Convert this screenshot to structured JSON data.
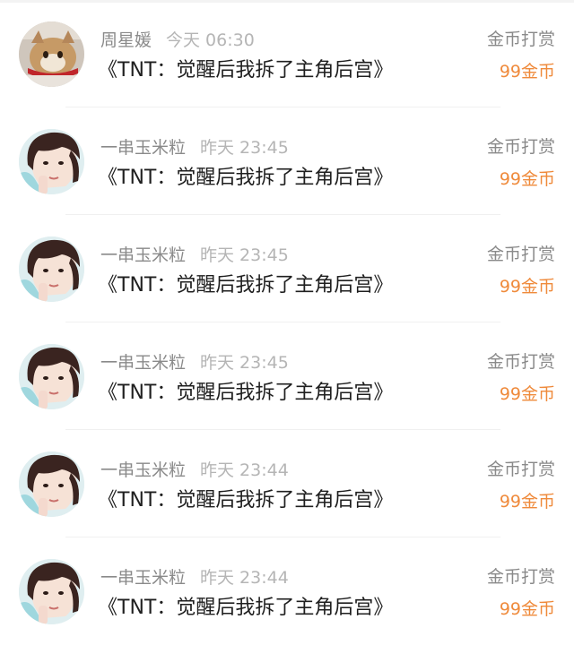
{
  "comments": [
    {
      "avatar": "cat-photo",
      "username": "周星媛",
      "time": "今天 06:30",
      "title": "《TNT：觉醒后我拆了主角后宫》",
      "reward_type": "金币打赏",
      "reward_amount": "99金币"
    },
    {
      "avatar": "boy-photo",
      "username": "一串玉米粒",
      "time": "昨天 23:45",
      "title": "《TNT：觉醒后我拆了主角后宫》",
      "reward_type": "金币打赏",
      "reward_amount": "99金币"
    },
    {
      "avatar": "boy-photo",
      "username": "一串玉米粒",
      "time": "昨天 23:45",
      "title": "《TNT：觉醒后我拆了主角后宫》",
      "reward_type": "金币打赏",
      "reward_amount": "99金币"
    },
    {
      "avatar": "boy-photo",
      "username": "一串玉米粒",
      "time": "昨天 23:45",
      "title": "《TNT：觉醒后我拆了主角后宫》",
      "reward_type": "金币打赏",
      "reward_amount": "99金币"
    },
    {
      "avatar": "boy-photo",
      "username": "一串玉米粒",
      "time": "昨天 23:44",
      "title": "《TNT：觉醒后我拆了主角后宫》",
      "reward_type": "金币打赏",
      "reward_amount": "99金币"
    },
    {
      "avatar": "boy-photo",
      "username": "一串玉米粒",
      "time": "昨天 23:44",
      "title": "《TNT：觉醒后我拆了主角后宫》",
      "reward_type": "金币打赏",
      "reward_amount": "99金币"
    }
  ],
  "colors": {
    "reward_amount": "#ef8a3b",
    "secondary_text": "#8a8a8a",
    "time_text": "#b5b5b5",
    "title_text": "#1f1f1f"
  }
}
